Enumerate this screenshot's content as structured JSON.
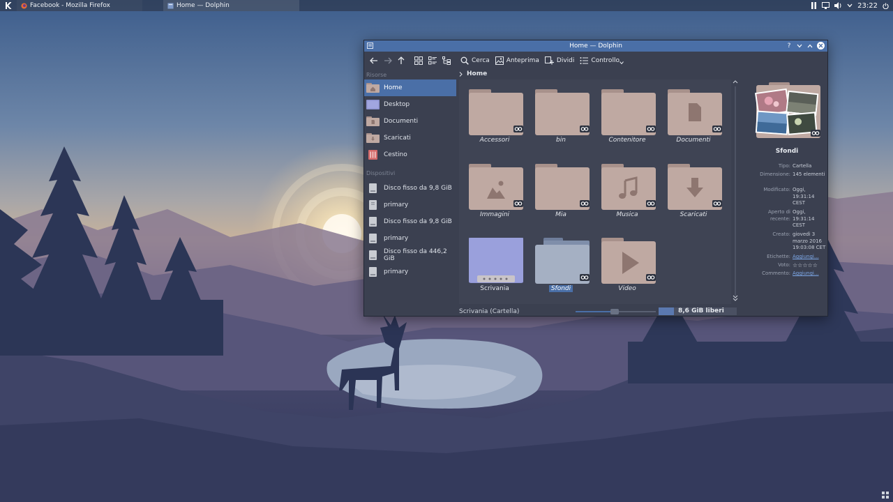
{
  "panel": {
    "tasks": [
      {
        "label": "Facebook - Mozilla Firefox"
      },
      {
        "label": "Home — Dolphin"
      }
    ],
    "clock": "23:22"
  },
  "window": {
    "title": "Home — Dolphin",
    "help_label": "?"
  },
  "toolbar": {
    "search_label": "Cerca",
    "preview_label": "Anteprima",
    "split_label": "Dividi",
    "control_label": "Controllo"
  },
  "sidebar": {
    "places_header": "Risorse",
    "places": [
      {
        "label": "Home",
        "icon": "home-folder-icon"
      },
      {
        "label": "Desktop",
        "icon": "desktop-icon"
      },
      {
        "label": "Documenti",
        "icon": "documents-folder-icon"
      },
      {
        "label": "Scaricati",
        "icon": "downloads-folder-icon"
      },
      {
        "label": "Cestino",
        "icon": "trash-icon"
      }
    ],
    "devices_header": "Dispositivi",
    "devices": [
      {
        "label": "Disco fisso da 9,8 GiB",
        "icon": "hard-disk-icon"
      },
      {
        "label": "primary",
        "icon": "hard-disk-icon"
      },
      {
        "label": "Disco fisso da 9,8 GiB",
        "icon": "hard-disk-icon"
      },
      {
        "label": "primary",
        "icon": "hard-disk-icon"
      },
      {
        "label": "Disco fisso da 446,2 GiB",
        "icon": "hard-disk-icon"
      },
      {
        "label": "primary",
        "icon": "hard-disk-icon"
      }
    ]
  },
  "breadcrumb": {
    "current": "Home"
  },
  "items": [
    {
      "label": "Accessori",
      "icon": "folder-link-icon"
    },
    {
      "label": "bin",
      "icon": "folder-link-icon"
    },
    {
      "label": "Contenitore",
      "icon": "folder-link-icon"
    },
    {
      "label": "Documenti",
      "icon": "documents-folder-icon"
    },
    {
      "label": "Immagini",
      "icon": "pictures-folder-icon"
    },
    {
      "label": "Mia",
      "icon": "folder-link-icon"
    },
    {
      "label": "Musica",
      "icon": "music-folder-icon"
    },
    {
      "label": "Scaricati",
      "icon": "downloads-folder-icon"
    },
    {
      "label": "Scrivania",
      "icon": "desktop-folder-icon"
    },
    {
      "label": "Sfondi",
      "icon": "wallpapers-folder-icon",
      "selected": true
    },
    {
      "label": "Video",
      "icon": "videos-folder-icon"
    }
  ],
  "info": {
    "name": "Sfondi",
    "rows": [
      {
        "key": "Tipo:",
        "value": "Cartella"
      },
      {
        "key": "Dimensione:",
        "value": "145 elementi"
      },
      {
        "key": "Modificato:",
        "value": "Oggi, 19:31:14 CEST"
      },
      {
        "key": "Aperto di recente:",
        "value": "Oggi, 19:31:14 CEST"
      },
      {
        "key": "Creato:",
        "value": "giovedì 3 marzo 2016 19:03:08 CET"
      },
      {
        "key": "Etichette:",
        "value": "Aggiungi..."
      },
      {
        "key": "Voto:",
        "value": "☆☆☆☆☆"
      },
      {
        "key": "Commento:",
        "value": "Aggiungi..."
      }
    ]
  },
  "status": {
    "text": "Scrivania (Cartella)",
    "free_space": "8,6 GiB liberi",
    "used_fraction": 0.2
  },
  "colors": {
    "accent": "#4a6fa7",
    "window_bg": "#3b4050",
    "folder": "#bfa9a2"
  }
}
